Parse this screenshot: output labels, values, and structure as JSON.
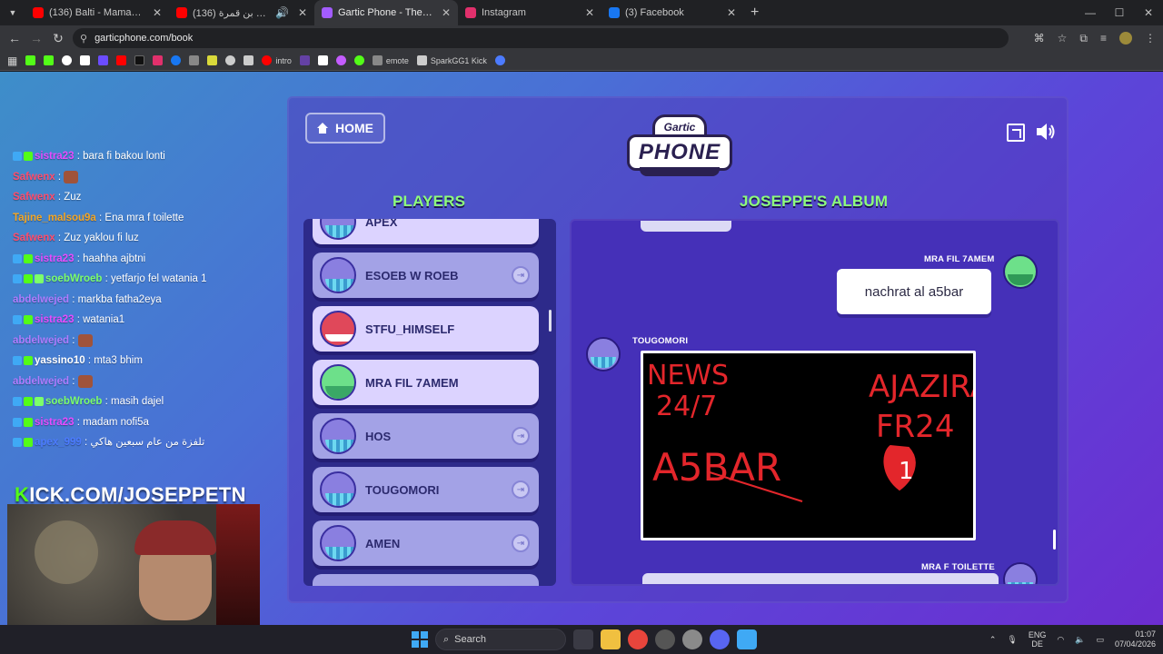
{
  "browser": {
    "tabs": [
      {
        "label": "(136) Balti - Mama (Live) - YouTube",
        "favicon": "#ff0000",
        "active": false
      },
      {
        "label": "(136) دنيا بخوت فوزي بن قمرة",
        "favicon": "#ff0000",
        "active": false
      },
      {
        "label": "Gartic Phone - The Telephone Game",
        "favicon": "#a35cff",
        "active": true
      },
      {
        "label": "Instagram",
        "favicon": "#e1306c",
        "active": false
      },
      {
        "label": "(3) Facebook",
        "favicon": "#1877f2",
        "active": false
      }
    ],
    "new_tab": "+",
    "url": "garticphone.com/book",
    "bookmarks": [
      {
        "label": "",
        "color": "#53fc18"
      },
      {
        "label": "",
        "color": "#53fc18"
      },
      {
        "label": "",
        "color": "#ffffff"
      },
      {
        "label": "",
        "color": "#ffffff"
      },
      {
        "label": "",
        "color": "#6b4cff"
      },
      {
        "label": "",
        "color": "#ff0000"
      },
      {
        "label": "",
        "color": "#111111"
      },
      {
        "label": "",
        "color": "#e1306c"
      },
      {
        "label": "",
        "color": "#1877f2"
      },
      {
        "label": "",
        "color": "#888888"
      },
      {
        "label": "",
        "color": "#d9d93a"
      },
      {
        "label": "",
        "color": "#cccccc"
      },
      {
        "label": "",
        "color": "#cccccc"
      },
      {
        "label": "intro",
        "color": "#ff0000"
      },
      {
        "label": "",
        "color": "#6441a5"
      },
      {
        "label": "",
        "color": "#ffffff"
      },
      {
        "label": "",
        "color": "#c45cff"
      },
      {
        "label": "",
        "color": "#53fc18"
      },
      {
        "label": "emote",
        "color": "#888888"
      },
      {
        "label": "SparkGG1 Kick",
        "color": "#cccccc"
      },
      {
        "label": "",
        "color": "#4c7bff"
      }
    ]
  },
  "stream": {
    "chat": [
      {
        "name": "sistra23",
        "name_color": "#e84bff",
        "text": ": bara fi bakou lonti",
        "badges": 2
      },
      {
        "name": "Safwenx",
        "name_color": "#ff4d6d",
        "text": ":",
        "emote": true
      },
      {
        "name": "Safwenx",
        "name_color": "#ff4d6d",
        "text": ": Zuz"
      },
      {
        "name": "Tajine_malsou9a",
        "name_color": "#f5a623",
        "text": ": Ena mra f toilette"
      },
      {
        "name": "Safwenx",
        "name_color": "#ff4d6d",
        "text": ": Zuz yaklou fi luz"
      },
      {
        "name": "sistra23",
        "name_color": "#e84bff",
        "text": ": haahha ajbtni",
        "badges": 2
      },
      {
        "name": "soebWroeb",
        "name_color": "#7cff6b",
        "text": ": yetfarjo fel watania 1",
        "badges": 3
      },
      {
        "name": "abdelwejed",
        "name_color": "#b07cff",
        "text": ": markba fatha2eya"
      },
      {
        "name": "sistra23",
        "name_color": "#e84bff",
        "text": ": watania1",
        "badges": 2
      },
      {
        "name": "abdelwejed",
        "name_color": "#b07cff",
        "text": ":",
        "emote": true
      },
      {
        "name": "yassino10",
        "name_color": "#ffffff",
        "text": ": mta3 bhim",
        "badges": 2
      },
      {
        "name": "abdelwejed",
        "name_color": "#b07cff",
        "text": ":",
        "emote": true
      },
      {
        "name": "soebWroeb",
        "name_color": "#7cff6b",
        "text": ": masih dajel",
        "badges": 3
      },
      {
        "name": "sistra23",
        "name_color": "#e84bff",
        "text": ": madam nofi5a",
        "badges": 2
      },
      {
        "name": "apex_999",
        "name_color": "#4c7bff",
        "text": ": تلفزة من عام سبعين هاكي",
        "badges": 2
      }
    ],
    "kick_url": "KICK.COM/JOSEPPETN"
  },
  "game": {
    "home_label": "HOME",
    "logo_top": "Gartic",
    "logo_main": "PHONE",
    "players_title": "PLAYERS",
    "album_title": "JOSEPPE'S ALBUM",
    "players": [
      {
        "name": "APEX",
        "style": "light",
        "avatar": "purple"
      },
      {
        "name": "ESOEB W ROEB",
        "style": "dim",
        "avatar": "purple",
        "kick": true
      },
      {
        "name": "STFU_HIMSELF",
        "style": "light",
        "avatar": "red"
      },
      {
        "name": "MRA FIL 7AMEM",
        "style": "light",
        "avatar": "green"
      },
      {
        "name": "HOS",
        "style": "dim",
        "avatar": "purple",
        "kick": true
      },
      {
        "name": "TOUGOMORI",
        "style": "dim",
        "avatar": "purple",
        "kick": true
      },
      {
        "name": "AMEN",
        "style": "dim",
        "avatar": "purple",
        "kick": true
      }
    ],
    "album": {
      "entry1_author": "MRA FIL 7AMEM",
      "entry1_text": "nachrat al a5bar",
      "entry2_author": "TOUGOMORI",
      "drawing_text": {
        "line1": "NEWS",
        "line2": "24/7",
        "line3": "AJAZIRA",
        "line4": "FR24",
        "line5": "A5BAR",
        "number": "1"
      },
      "entry3_author": "MRA F TOILETTE"
    }
  },
  "taskbar": {
    "search_placeholder": "Search",
    "lang_line1": "ENG",
    "lang_line2": "DE",
    "time": "01:07",
    "date": "07/04/2026"
  }
}
